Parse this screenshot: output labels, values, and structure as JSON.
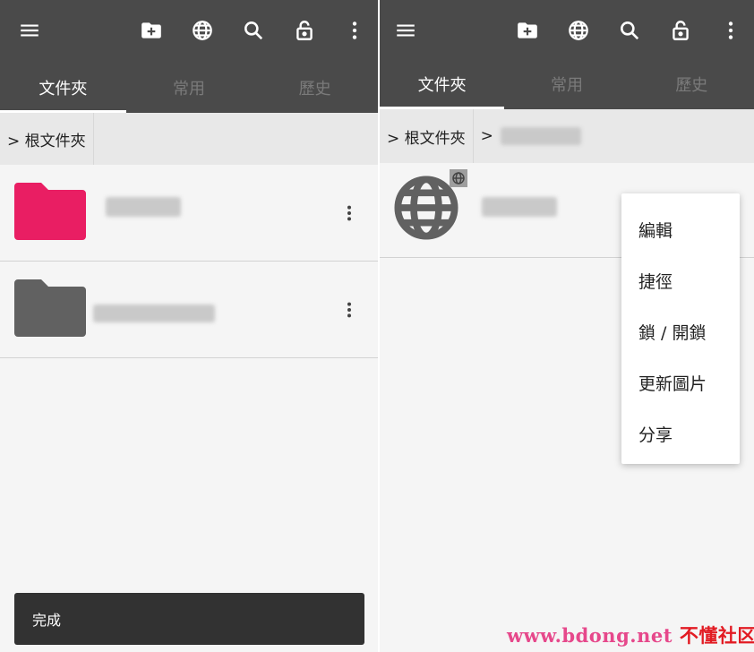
{
  "left": {
    "tabs": [
      {
        "label": "文件夾",
        "active": true
      },
      {
        "label": "常用",
        "active": false
      },
      {
        "label": "歷史",
        "active": false
      }
    ],
    "breadcrumb": {
      "root": "> 根文件夾"
    },
    "folders": [
      {
        "color": "#e91e63"
      },
      {
        "color": "#616161"
      }
    ],
    "snackbar": {
      "message": "完成"
    }
  },
  "right": {
    "tabs": [
      {
        "label": "文件夾",
        "active": true
      },
      {
        "label": "常用",
        "active": false
      },
      {
        "label": "歷史",
        "active": false
      }
    ],
    "breadcrumb": {
      "root": "> 根文件夾",
      "separator": ">"
    },
    "context_menu": {
      "items": [
        {
          "label": "編輯"
        },
        {
          "label": "捷徑"
        },
        {
          "label": "鎖 / 開鎖"
        },
        {
          "label": "更新圖片"
        },
        {
          "label": "分享"
        }
      ]
    }
  },
  "toolbar": {
    "icons": [
      "menu-icon",
      "new-folder-icon",
      "globe-icon",
      "search-icon",
      "unlock-icon",
      "more-vert-icon"
    ]
  },
  "watermark": {
    "site": "www.bdong.net",
    "brand": "不懂社区"
  },
  "colors": {
    "appbar": "#4a4a4a",
    "background": "#f5f5f5",
    "breadcrumb": "#e8e8e8",
    "snackbar": "#323232",
    "accent_folder": "#e91e63"
  }
}
